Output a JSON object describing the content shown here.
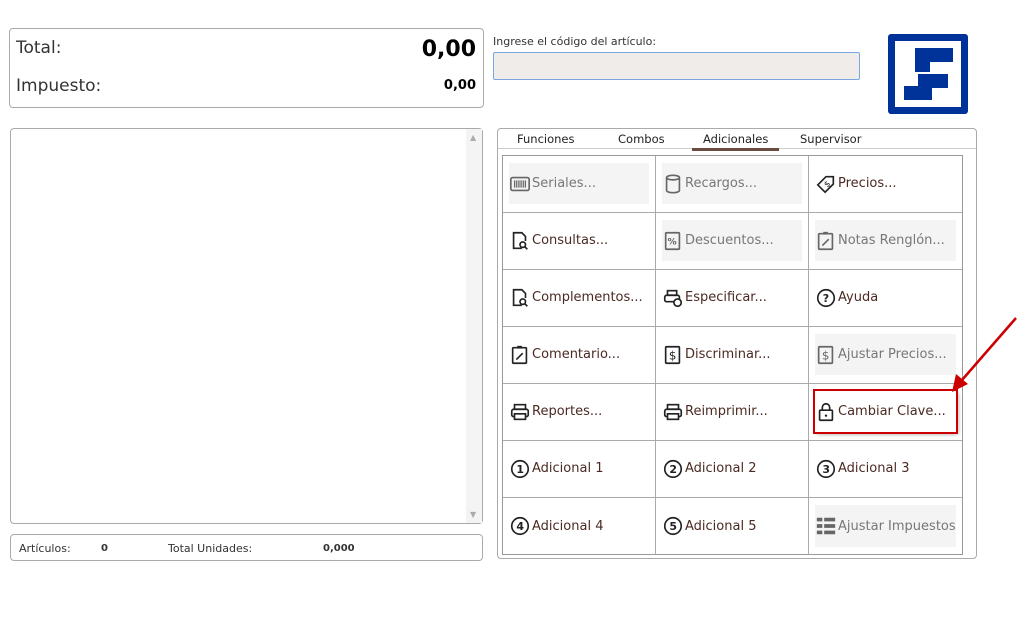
{
  "totals": {
    "total_label": "Total:",
    "total_value": "0,00",
    "tax_label": "Impuesto:",
    "tax_value": "0,00"
  },
  "code": {
    "label": "Ingrese el código del artículo:",
    "value": "",
    "placeholder": ""
  },
  "status": {
    "articles_label": "Artículos:",
    "articles_value": "0",
    "units_label": "Total Unidades:",
    "units_value": "0,000"
  },
  "tabs": [
    {
      "label": "Funciones"
    },
    {
      "label": "Combos"
    },
    {
      "label": "Adicionales",
      "active": true
    },
    {
      "label": "Supervisor"
    }
  ],
  "buttons": [
    {
      "label": "Seriales...",
      "icon": "barcode-icon",
      "disabled": true
    },
    {
      "label": "Recargos...",
      "icon": "database-icon",
      "disabled": true
    },
    {
      "label": "Precios...",
      "icon": "price-tag-icon"
    },
    {
      "label": "Consultas...",
      "icon": "document-search-icon"
    },
    {
      "label": "Descuentos...",
      "icon": "percent-icon",
      "disabled": true
    },
    {
      "label": "Notas Renglón...",
      "icon": "clipboard-edit-icon",
      "disabled": true
    },
    {
      "label": "Complementos...",
      "icon": "document-search-icon"
    },
    {
      "label": "Especificar...",
      "icon": "printer-check-icon"
    },
    {
      "label": "Ayuda",
      "icon": "help-circle-icon"
    },
    {
      "label": "Comentario...",
      "icon": "clipboard-edit-icon"
    },
    {
      "label": "Discriminar...",
      "icon": "dollar-doc-icon"
    },
    {
      "label": "Ajustar Precios...",
      "icon": "dollar-doc-icon",
      "disabled": true
    },
    {
      "label": "Reportes...",
      "icon": "printer-icon"
    },
    {
      "label": "Reimprimir...",
      "icon": "printer-icon"
    },
    {
      "label": "Cambiar Clave...",
      "icon": "lock-icon",
      "highlighted": true
    },
    {
      "label": "Adicional 1",
      "icon": "circle-1-icon",
      "num": "1"
    },
    {
      "label": "Adicional 2",
      "icon": "circle-2-icon",
      "num": "2"
    },
    {
      "label": "Adicional 3",
      "icon": "circle-3-icon",
      "num": "3"
    },
    {
      "label": "Adicional 4",
      "icon": "circle-4-icon",
      "num": "4"
    },
    {
      "label": "Adicional 5",
      "icon": "circle-5-icon",
      "num": "5"
    },
    {
      "label": "Ajustar Impuestos...",
      "icon": "table-grid-icon",
      "disabled": true
    }
  ],
  "colors": {
    "logo": "#003399",
    "highlight": "#cc0000",
    "tab_underline": "#6b4a40"
  }
}
